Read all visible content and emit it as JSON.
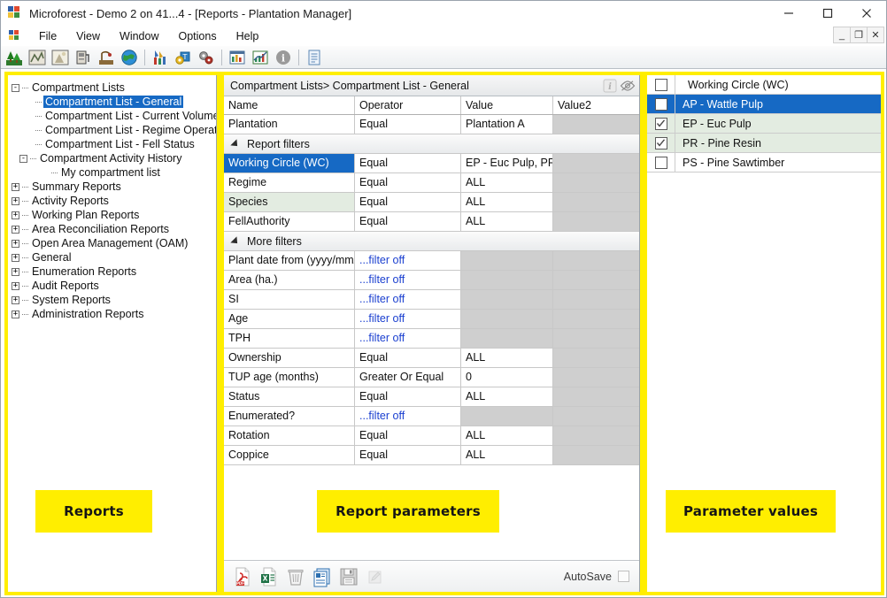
{
  "window": {
    "title": "Microforest - Demo 2 on 41...4 - [Reports - Plantation Manager]",
    "minimize_label": "—",
    "maximize_label": "☐",
    "close_label": "✕",
    "mdi_minimize_label": "_",
    "mdi_restore_label": "❐",
    "mdi_close_label": "✕"
  },
  "menu": {
    "items": [
      {
        "label": "File"
      },
      {
        "label": "View"
      },
      {
        "label": "Window"
      },
      {
        "label": "Options"
      },
      {
        "label": "Help"
      }
    ]
  },
  "toolbar": {
    "icons": [
      {
        "name": "plantation-icon"
      },
      {
        "name": "compartment-icon"
      },
      {
        "name": "survey-icon"
      },
      {
        "name": "fuel-station-icon"
      },
      {
        "name": "harvest-icon"
      },
      {
        "name": "globe-icon"
      },
      {
        "name": "tools-icon"
      },
      {
        "name": "settings-gear-icon"
      },
      {
        "name": "advanced-gear-icon"
      },
      {
        "name": "bar-chart-icon"
      },
      {
        "name": "line-chart-icon"
      },
      {
        "name": "info-icon"
      },
      {
        "name": "document-icon"
      }
    ]
  },
  "tree": {
    "nodes": [
      {
        "label": "Compartment Lists",
        "level": 0,
        "toggle": "-",
        "selected": false
      },
      {
        "label": "Compartment List - General",
        "level": 2,
        "toggle": "",
        "selected": true
      },
      {
        "label": "Compartment List - Current Volumes",
        "level": 2,
        "toggle": "",
        "selected": false
      },
      {
        "label": "Compartment List - Regime Operations",
        "level": 2,
        "toggle": "",
        "selected": false
      },
      {
        "label": "Compartment List - Fell Status",
        "level": 2,
        "toggle": "",
        "selected": false
      },
      {
        "label": "Compartment Activity History",
        "level": 1,
        "toggle": "-",
        "selected": false
      },
      {
        "label": "My compartment list",
        "level": 3,
        "toggle": "",
        "selected": false
      },
      {
        "label": "Summary Reports",
        "level": 0,
        "toggle": "+",
        "selected": false
      },
      {
        "label": "Activity Reports",
        "level": 0,
        "toggle": "+",
        "selected": false
      },
      {
        "label": "Working Plan Reports",
        "level": 0,
        "toggle": "+",
        "selected": false
      },
      {
        "label": "Area Reconciliation Reports",
        "level": 0,
        "toggle": "+",
        "selected": false
      },
      {
        "label": "Open Area Management (OAM)",
        "level": 0,
        "toggle": "+",
        "selected": false
      },
      {
        "label": "General",
        "level": 0,
        "toggle": "+",
        "selected": false
      },
      {
        "label": "Enumeration Reports",
        "level": 0,
        "toggle": "+",
        "selected": false
      },
      {
        "label": "Audit Reports",
        "level": 0,
        "toggle": "+",
        "selected": false
      },
      {
        "label": "System Reports",
        "level": 0,
        "toggle": "+",
        "selected": false
      },
      {
        "label": "Administration Reports",
        "level": 0,
        "toggle": "+",
        "selected": false
      }
    ]
  },
  "parameters_panel": {
    "breadcrumb": "Compartment Lists> Compartment List - General",
    "info_icon": "info-icon",
    "hide_icon": "eye-slash-icon",
    "columns": [
      "Name",
      "Operator",
      "Value",
      "Value2"
    ],
    "rows": [
      {
        "kind": "row",
        "name": "Plantation",
        "operator": "Equal",
        "value": "Plantation A",
        "value2": "",
        "selected": false,
        "tint": false,
        "filter_off": false
      },
      {
        "kind": "group",
        "name": "Report filters"
      },
      {
        "kind": "row",
        "name": "Working Circle (WC)",
        "operator": "Equal",
        "value": "EP - Euc Pulp, PR...",
        "value2": "",
        "selected": true,
        "tint": false,
        "filter_off": false
      },
      {
        "kind": "row",
        "name": "Regime",
        "operator": "Equal",
        "value": "ALL",
        "value2": "",
        "selected": false,
        "tint": false,
        "filter_off": false
      },
      {
        "kind": "row",
        "name": "Species",
        "operator": "Equal",
        "value": "ALL",
        "value2": "",
        "selected": false,
        "tint": true,
        "filter_off": false
      },
      {
        "kind": "row",
        "name": "FellAuthority",
        "operator": "Equal",
        "value": "ALL",
        "value2": "",
        "selected": false,
        "tint": false,
        "filter_off": false
      },
      {
        "kind": "group",
        "name": "More filters"
      },
      {
        "kind": "row",
        "name": "Plant date from (yyyy/mm/dd)",
        "operator": "...filter off",
        "value": "",
        "value2": "",
        "selected": false,
        "tint": false,
        "filter_off": true
      },
      {
        "kind": "row",
        "name": "Area (ha.)",
        "operator": "...filter off",
        "value": "",
        "value2": "",
        "selected": false,
        "tint": false,
        "filter_off": true
      },
      {
        "kind": "row",
        "name": "SI",
        "operator": "...filter off",
        "value": "",
        "value2": "",
        "selected": false,
        "tint": false,
        "filter_off": true
      },
      {
        "kind": "row",
        "name": "Age",
        "operator": "...filter off",
        "value": "",
        "value2": "",
        "selected": false,
        "tint": false,
        "filter_off": true
      },
      {
        "kind": "row",
        "name": "TPH",
        "operator": "...filter off",
        "value": "",
        "value2": "",
        "selected": false,
        "tint": false,
        "filter_off": true
      },
      {
        "kind": "row",
        "name": "Ownership",
        "operator": "Equal",
        "value": "ALL",
        "value2": "",
        "selected": false,
        "tint": false,
        "filter_off": false
      },
      {
        "kind": "row",
        "name": "TUP age (months)",
        "operator": "Greater Or Equal",
        "value": "0",
        "value2": "",
        "selected": false,
        "tint": false,
        "filter_off": false
      },
      {
        "kind": "row",
        "name": "Status",
        "operator": "Equal",
        "value": "ALL",
        "value2": "",
        "selected": false,
        "tint": false,
        "filter_off": false
      },
      {
        "kind": "row",
        "name": "Enumerated?",
        "operator": "...filter off",
        "value": "",
        "value2": "",
        "selected": false,
        "tint": false,
        "filter_off": true
      },
      {
        "kind": "row",
        "name": "Rotation",
        "operator": "Equal",
        "value": "ALL",
        "value2": "",
        "selected": false,
        "tint": false,
        "filter_off": false
      },
      {
        "kind": "row",
        "name": "Coppice",
        "operator": "Equal",
        "value": "ALL",
        "value2": "",
        "selected": false,
        "tint": false,
        "filter_off": false
      }
    ],
    "footer": {
      "icons": [
        {
          "name": "export-pdf-icon"
        },
        {
          "name": "export-excel-icon"
        },
        {
          "name": "delete-trash-icon"
        },
        {
          "name": "report-preview-icon"
        },
        {
          "name": "save-icon"
        },
        {
          "name": "edit-pencil-icon"
        }
      ],
      "autosave_label": "AutoSave",
      "autosave_checked": false
    }
  },
  "values_panel": {
    "header": {
      "label": "Working Circle (WC)",
      "checked": false
    },
    "items": [
      {
        "label": "AP - Wattle Pulp",
        "checked": false,
        "selected": true
      },
      {
        "label": "EP - Euc Pulp",
        "checked": true,
        "selected": false
      },
      {
        "label": "PR - Pine Resin",
        "checked": true,
        "selected": false
      },
      {
        "label": "PS - Pine Sawtimber",
        "checked": false,
        "selected": false
      }
    ]
  },
  "annotations": {
    "reports": "Reports",
    "report_parameters": "Report parameters",
    "parameter_values": "Parameter values"
  },
  "colors": {
    "selection_blue": "#1669c4",
    "annotation_yellow": "#ffee00",
    "tint_green": "#e3ece1",
    "disabled_gray": "#cfcfcf"
  }
}
